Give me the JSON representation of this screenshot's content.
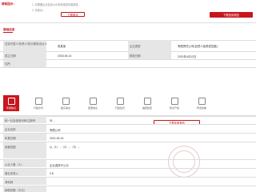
{
  "notice": {
    "title": "帮助提示：",
    "line1": "1. 请根据企业信息公示系统报送年度报告...",
    "line2": "2. 请核对...",
    "button": "下载报告"
  },
  "basic": {
    "section_title": "基础信息",
    "button": "下载信用报告",
    "rows": [
      {
        "label": "法定代表人/负责人/执行事务合伙人",
        "value": "张某某",
        "label2": "企业类型",
        "value2": "有限责任公司(自然人投资或控股)"
      },
      {
        "label": "成立日期",
        "value": "2018-06-14",
        "label2": "核准日期",
        "value2": "2021年4月12日"
      },
      {
        "label": "住所",
        "value": "",
        "label2": "",
        "value2": ""
      }
    ]
  },
  "tabs": [
    {
      "label": "年报信息",
      "active": true
    },
    {
      "label": "行政许可",
      "active": false
    },
    {
      "label": "股东信息",
      "active": false
    },
    {
      "label": "变更信息",
      "active": false
    },
    {
      "label": "行政处罚",
      "active": false
    },
    {
      "label": "抽查检查",
      "active": false
    },
    {
      "label": "知识产权",
      "active": false
    },
    {
      "label": "司法协助",
      "active": false
    }
  ],
  "report": {
    "section_title": "年报信息",
    "badge": "下载年度报告",
    "rows": [
      {
        "label": "统一社会信用代码/注册号",
        "value": "91..."
      },
      {
        "label": "企业名称",
        "value": "有限公司"
      },
      {
        "label": "年报日期",
        "value": "2021-06-24"
      },
      {
        "label": "经营范围",
        "value": "以（1）...（2）...（3）..."
      },
      {
        "label": "从业人数（人）",
        "value": "企业选择不公示"
      },
      {
        "label": "营业总收入",
        "value": "0.8"
      },
      {
        "label": "净利润",
        "value": ""
      },
      {
        "label": "纳税总额（万元）",
        "value": ""
      }
    ]
  },
  "colors": {
    "accent": "#c8161d"
  }
}
